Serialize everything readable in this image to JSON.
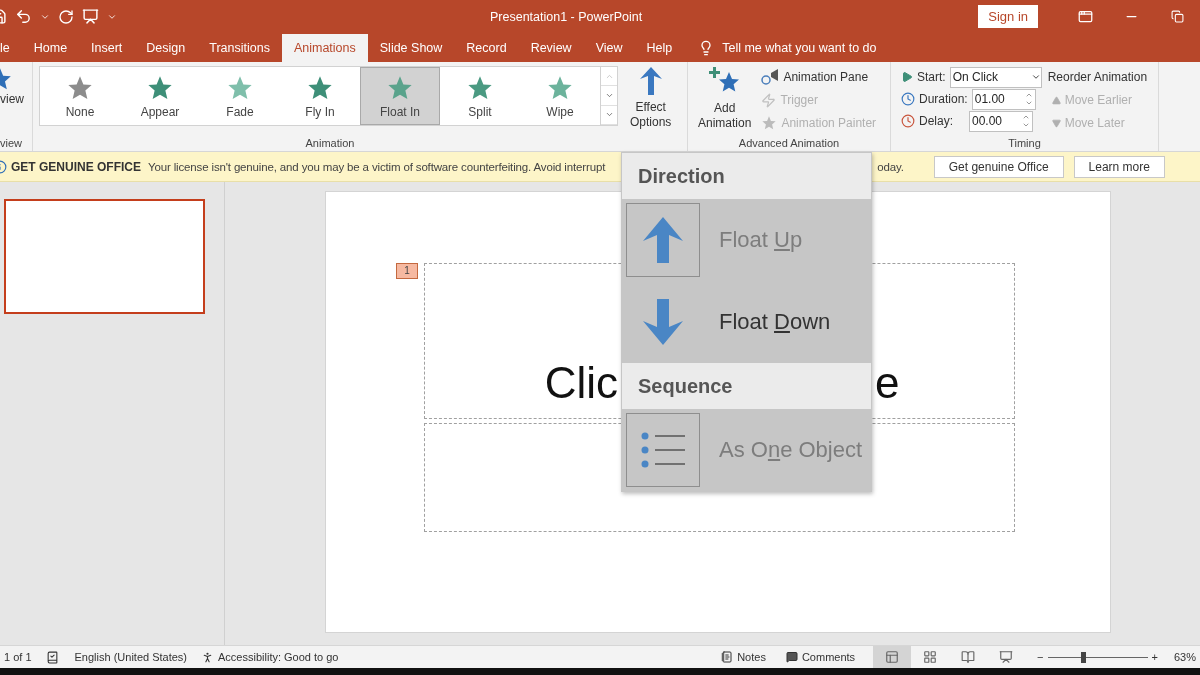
{
  "title_bar": {
    "title": "Presentation1  -  PowerPoint",
    "sign_in": "Sign in"
  },
  "tabs": [
    {
      "label": "le",
      "selected": false
    },
    {
      "label": "Home",
      "selected": false
    },
    {
      "label": "Insert",
      "selected": false
    },
    {
      "label": "Design",
      "selected": false
    },
    {
      "label": "Transitions",
      "selected": false
    },
    {
      "label": "Animations",
      "selected": true
    },
    {
      "label": "Slide Show",
      "selected": false
    },
    {
      "label": "Record",
      "selected": false
    },
    {
      "label": "Review",
      "selected": false
    },
    {
      "label": "View",
      "selected": false
    },
    {
      "label": "Help",
      "selected": false
    }
  ],
  "tell_me": "Tell me what you want to do",
  "preview": {
    "label": "view",
    "group": "view"
  },
  "gallery": {
    "group": "Animation",
    "items": [
      {
        "label": "None",
        "color": "#8c8c8c",
        "selected": false
      },
      {
        "label": "Appear",
        "color": "#3e8f78",
        "selected": false
      },
      {
        "label": "Fade",
        "color": "#7fbfab",
        "selected": false
      },
      {
        "label": "Fly In",
        "color": "#3e8f78",
        "selected": false
      },
      {
        "label": "Float In",
        "color": "#5aa38c",
        "selected": true
      },
      {
        "label": "Split",
        "color": "#4b9a82",
        "selected": false
      },
      {
        "label": "Wipe",
        "color": "#6cb39c",
        "selected": false
      }
    ]
  },
  "effect_options": {
    "line_1": "Effect",
    "line_2": "Options"
  },
  "advanced": {
    "group": "Advanced Animation",
    "add_line_1": "Add",
    "add_line_2": "Animation",
    "commands": [
      {
        "kind": "pane",
        "label": "Animation Pane",
        "disabled": false
      },
      {
        "kind": "trigger",
        "label": "Trigger",
        "disabled": true
      },
      {
        "kind": "painter",
        "label": "Animation Painter",
        "disabled": true
      }
    ]
  },
  "timing": {
    "group": "Timing",
    "start_label": "Start:",
    "start_value": "On Click",
    "duration_label": "Duration:",
    "duration_value": "01.00",
    "delay_label": "Delay:",
    "delay_value": "00.00",
    "reorder_title": "Reorder Animation",
    "reorder": [
      {
        "kind": "earlier",
        "label": "Move Earlier",
        "disabled": true
      },
      {
        "kind": "later",
        "label": "Move Later",
        "disabled": true
      }
    ]
  },
  "notice": {
    "title": "GET GENUINE OFFICE",
    "message_before": "Your license isn't genuine, and you may be a victim of software counterfeiting. Avoid interrupt",
    "message_after": "oday.",
    "buttons": [
      "Get genuine Office",
      "Learn more"
    ]
  },
  "slide": {
    "animation_badge": "1",
    "title_left": "Clic",
    "title_right": "e"
  },
  "menu": {
    "sections": [
      {
        "heading": "Direction",
        "items": [
          {
            "kind": "up",
            "before": "Float ",
            "key": "U",
            "after": "p",
            "checked": true,
            "selected": false
          },
          {
            "kind": "down",
            "before": "Float ",
            "key": "D",
            "after": "own",
            "checked": false,
            "selected": true
          }
        ]
      },
      {
        "heading": "Sequence",
        "items": [
          {
            "kind": "list",
            "before": "As O",
            "key": "n",
            "after": "e Object",
            "checked": true,
            "selected": false
          }
        ]
      }
    ]
  },
  "status": {
    "slide": "1 of 1",
    "language": "English (United States)",
    "accessibility": "Accessibility: Good to go",
    "notes": "Notes",
    "comments": "Comments",
    "views": [
      {
        "kind": "normal",
        "selected": true
      },
      {
        "kind": "sorter",
        "selected": false
      },
      {
        "kind": "reading",
        "selected": false
      },
      {
        "kind": "show",
        "selected": false
      }
    ],
    "zoom": {
      "minus": "−",
      "plus": "+",
      "level": 0.35,
      "reading": "63%"
    }
  }
}
